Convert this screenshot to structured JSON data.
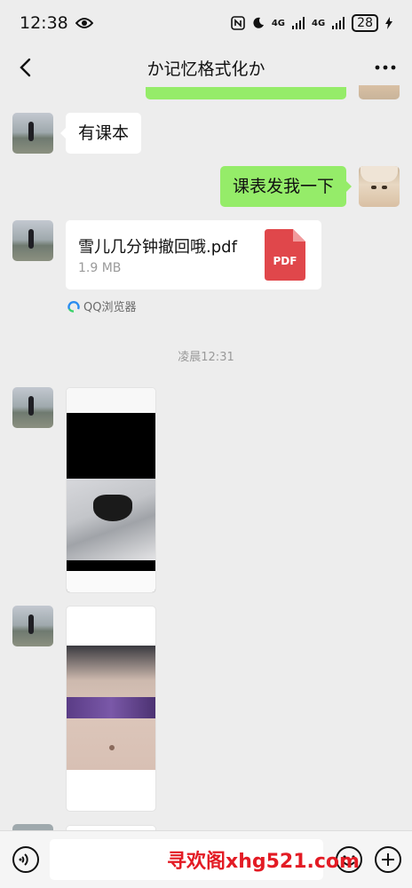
{
  "status_bar": {
    "time": "12:38",
    "network1": "4G",
    "network2": "4G",
    "battery": "28"
  },
  "header": {
    "title": "か记忆格式化か"
  },
  "messages": {
    "msg1": "有课本",
    "msg2": "课表发我一下",
    "file": {
      "name": "雪儿几分钟撤回哦.pdf",
      "size": "1.9 MB",
      "icon_label": "PDF"
    },
    "source_app": "QQ浏览器",
    "time_divider": "凌晨12:31"
  },
  "input_bar": {
    "placeholder": "",
    "watermark": "寻欢阁xhg521.com"
  },
  "colors": {
    "bubble_green": "#95ec69",
    "bubble_white": "#ffffff",
    "background": "#ededed",
    "pdf_red": "#e0474b",
    "watermark_red": "#e31b24"
  }
}
